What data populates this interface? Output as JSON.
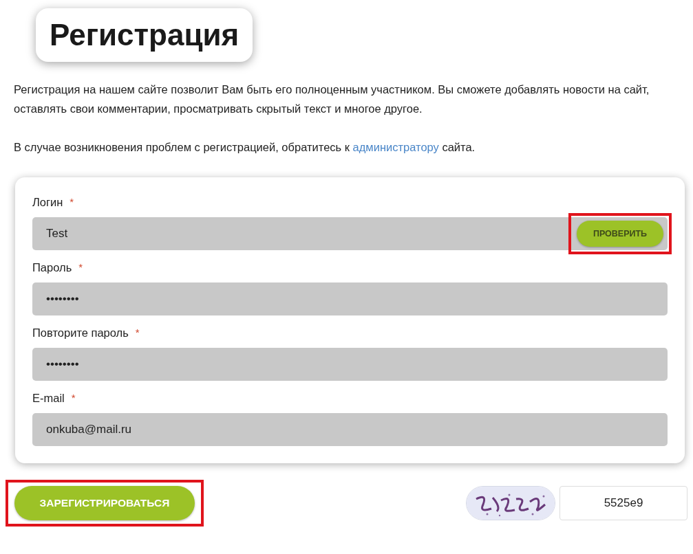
{
  "title": "Регистрация",
  "intro": [
    "Регистрация на нашем сайте позволит Вам быть его полноценным участником. Вы сможете добавлять новости на сайт, оставлять свои комментарии, просматривать скрытый текст и многое другое."
  ],
  "help": {
    "before": "В случае возникновения проблем с регистрацией, обратитесь к ",
    "link": "администратору",
    "after": " сайта."
  },
  "fields": [
    {
      "label": "Логин",
      "required": "*",
      "value": "Test",
      "button": {
        "label": "ПРОВЕРИТЬ",
        "highlighted": true
      }
    },
    {
      "label": "Пароль",
      "required": "*",
      "value": "••••••••"
    },
    {
      "label": "Повторите пароль",
      "required": "*",
      "value": "••••••••"
    },
    {
      "label": "E-mail",
      "required": "*",
      "value": "onkuba@mail.ru"
    }
  ],
  "submit": {
    "label": "ЗАРЕГИСТРИРОВАТЬСЯ",
    "highlighted": true
  },
  "captcha": {
    "kind": "picture",
    "value": "5525e9"
  }
}
